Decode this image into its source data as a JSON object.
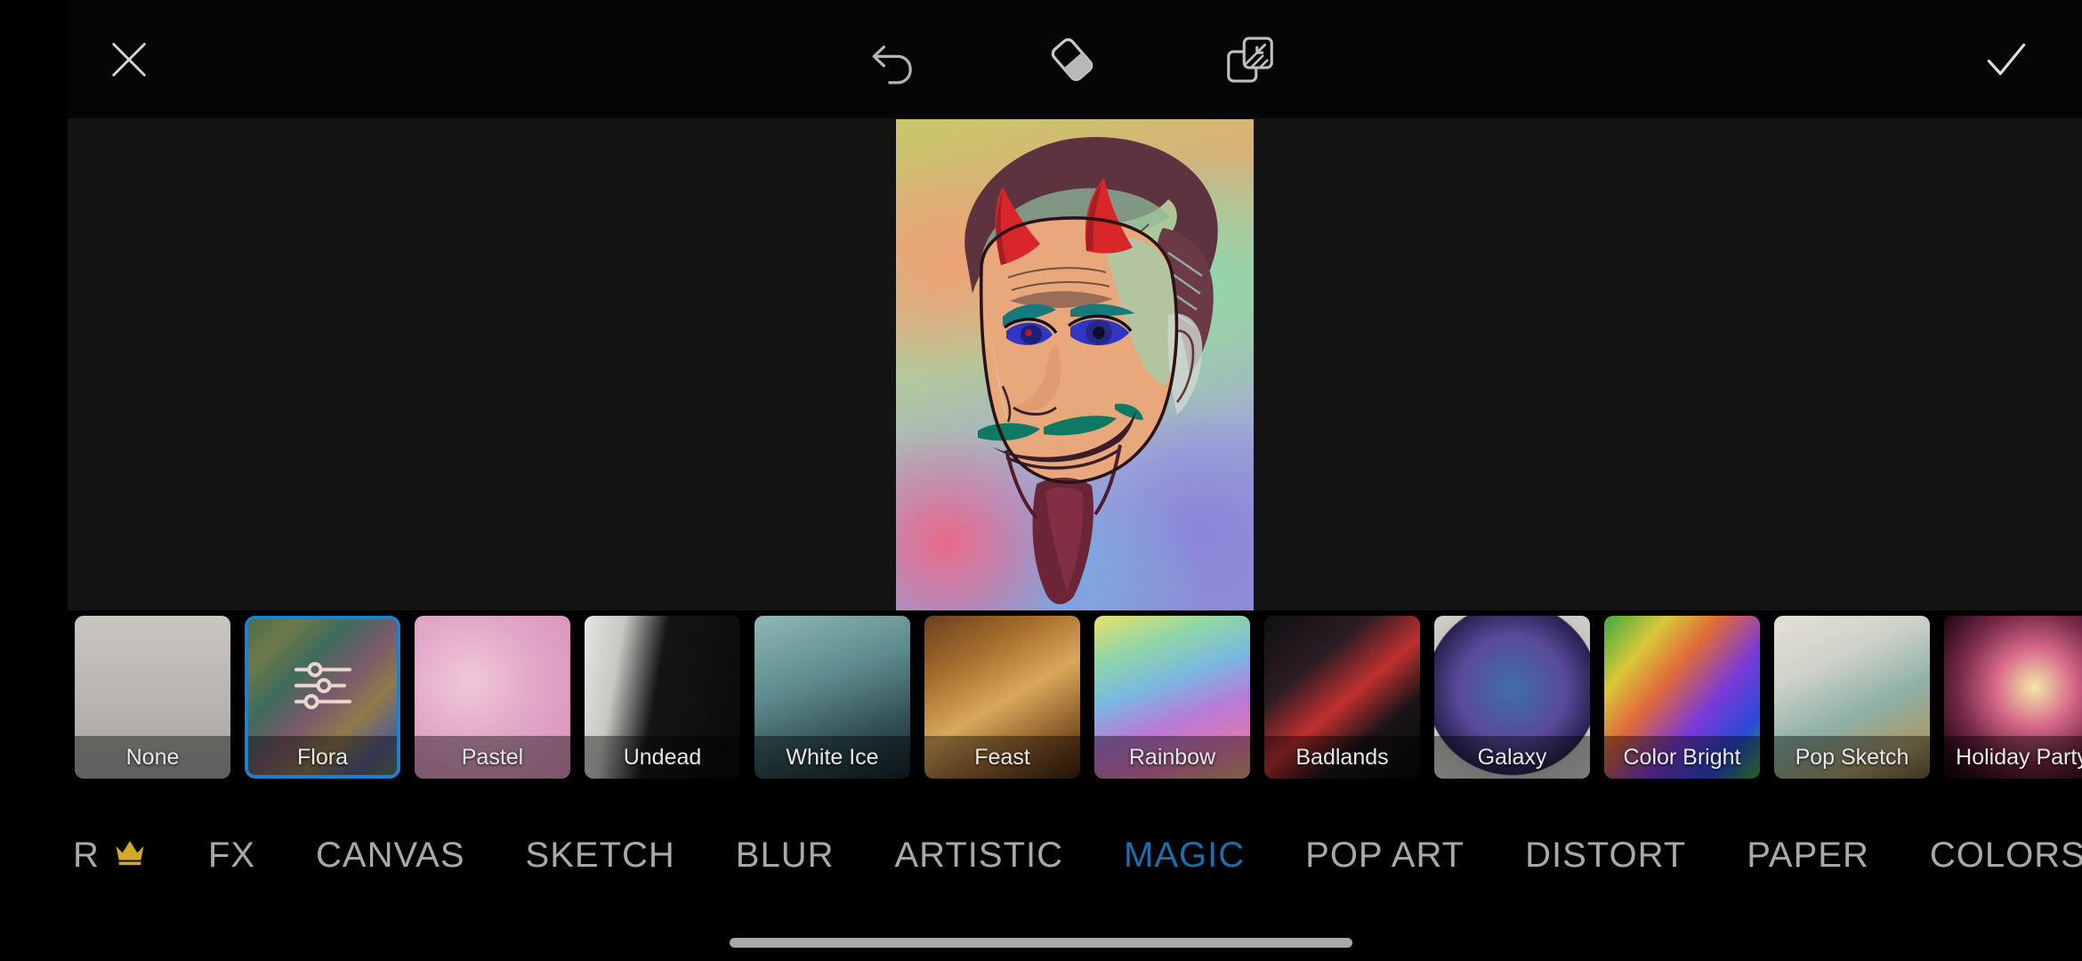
{
  "app": {
    "theme_bg": "#000000",
    "accent": "#1d6fa8",
    "selection_border": "#1d82c9",
    "crown_color": "#d4a82a"
  },
  "topbar": {
    "close_label": "close-icon",
    "undo_label": "undo-icon",
    "eraser_label": "eraser-icon",
    "mask_label": "mask-overlay-icon",
    "done_label": "checkmark-icon"
  },
  "canvas": {
    "artwork_title": "Devil face colored sketch",
    "artwork_description": "Colored pencil drawing of a grinning devil with red horns, teal eyebrows, blue eyes and a green moustache over a rainbow gradient background"
  },
  "effects": {
    "selected": "Flora",
    "items": [
      {
        "label": "None",
        "selected": false
      },
      {
        "label": "Flora",
        "selected": true
      },
      {
        "label": "Pastel",
        "selected": false
      },
      {
        "label": "Undead",
        "selected": false
      },
      {
        "label": "White Ice",
        "selected": false
      },
      {
        "label": "Feast",
        "selected": false
      },
      {
        "label": "Rainbow",
        "selected": false
      },
      {
        "label": "Badlands",
        "selected": false
      },
      {
        "label": "Galaxy",
        "selected": false
      },
      {
        "label": "Color Bright",
        "selected": false
      },
      {
        "label": "Pop Sketch",
        "selected": false
      },
      {
        "label": "Holiday Party",
        "selected": false
      }
    ]
  },
  "nav": {
    "active": "MAGIC",
    "items": [
      {
        "label": "R",
        "active": false,
        "crown": true
      },
      {
        "label": "FX",
        "active": false,
        "crown": false
      },
      {
        "label": "CANVAS",
        "active": false,
        "crown": false
      },
      {
        "label": "SKETCH",
        "active": false,
        "crown": false
      },
      {
        "label": "BLUR",
        "active": false,
        "crown": false
      },
      {
        "label": "ARTISTIC",
        "active": false,
        "crown": false
      },
      {
        "label": "MAGIC",
        "active": true,
        "crown": false
      },
      {
        "label": "POP ART",
        "active": false,
        "crown": false
      },
      {
        "label": "DISTORT",
        "active": false,
        "crown": false
      },
      {
        "label": "PAPER",
        "active": false,
        "crown": false
      },
      {
        "label": "COLORS",
        "active": false,
        "crown": false
      }
    ]
  },
  "system": {
    "home_indicator": "home-indicator"
  }
}
